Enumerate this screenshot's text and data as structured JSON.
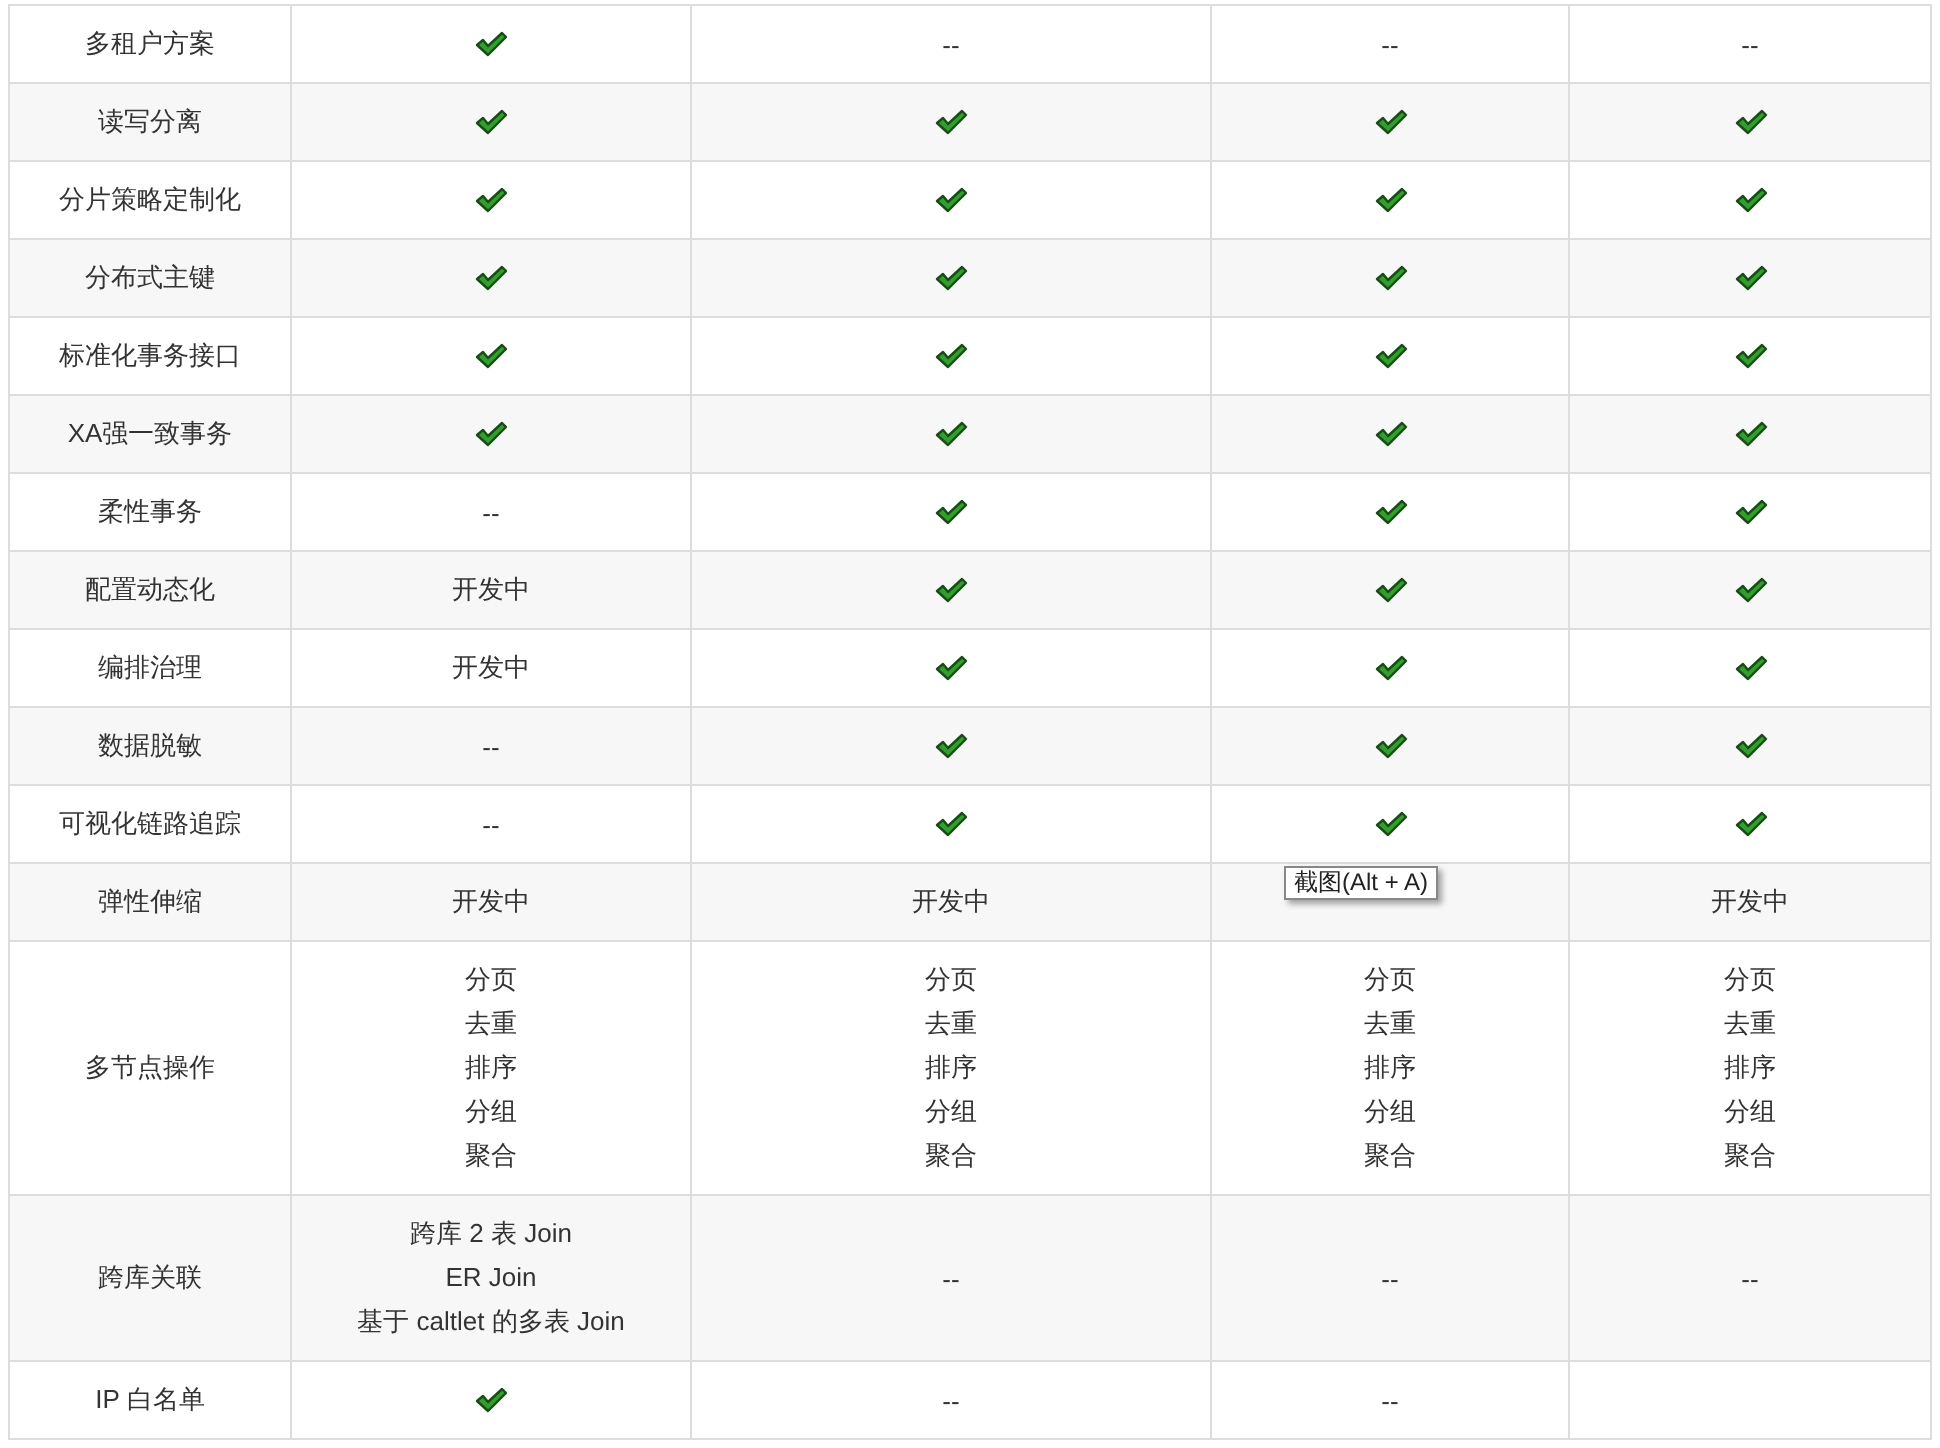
{
  "table": {
    "rows": [
      {
        "label": "多租户方案",
        "cells": [
          {
            "kind": "check"
          },
          {
            "kind": "text",
            "text": "--"
          },
          {
            "kind": "text",
            "text": "--"
          },
          {
            "kind": "text",
            "text": "--"
          }
        ]
      },
      {
        "label": "读写分离",
        "cells": [
          {
            "kind": "check"
          },
          {
            "kind": "check"
          },
          {
            "kind": "check"
          },
          {
            "kind": "check"
          }
        ]
      },
      {
        "label": "分片策略定制化",
        "cells": [
          {
            "kind": "check"
          },
          {
            "kind": "check"
          },
          {
            "kind": "check"
          },
          {
            "kind": "check"
          }
        ]
      },
      {
        "label": "分布式主键",
        "cells": [
          {
            "kind": "check"
          },
          {
            "kind": "check"
          },
          {
            "kind": "check"
          },
          {
            "kind": "check"
          }
        ]
      },
      {
        "label": "标准化事务接口",
        "cells": [
          {
            "kind": "check"
          },
          {
            "kind": "check"
          },
          {
            "kind": "check"
          },
          {
            "kind": "check"
          }
        ]
      },
      {
        "label": "XA强一致事务",
        "cells": [
          {
            "kind": "check"
          },
          {
            "kind": "check"
          },
          {
            "kind": "check"
          },
          {
            "kind": "check"
          }
        ]
      },
      {
        "label": "柔性事务",
        "cells": [
          {
            "kind": "text",
            "text": "--"
          },
          {
            "kind": "check"
          },
          {
            "kind": "check"
          },
          {
            "kind": "check"
          }
        ]
      },
      {
        "label": "配置动态化",
        "cells": [
          {
            "kind": "text",
            "text": "开发中"
          },
          {
            "kind": "check"
          },
          {
            "kind": "check"
          },
          {
            "kind": "check"
          }
        ]
      },
      {
        "label": "编排治理",
        "cells": [
          {
            "kind": "text",
            "text": "开发中"
          },
          {
            "kind": "check"
          },
          {
            "kind": "check"
          },
          {
            "kind": "check"
          }
        ]
      },
      {
        "label": "数据脱敏",
        "cells": [
          {
            "kind": "text",
            "text": "--"
          },
          {
            "kind": "check"
          },
          {
            "kind": "check"
          },
          {
            "kind": "check"
          }
        ]
      },
      {
        "label": "可视化链路追踪",
        "cells": [
          {
            "kind": "text",
            "text": "--"
          },
          {
            "kind": "check"
          },
          {
            "kind": "check"
          },
          {
            "kind": "check"
          }
        ]
      },
      {
        "label": "弹性伸缩",
        "cells": [
          {
            "kind": "text",
            "text": "开发中"
          },
          {
            "kind": "text",
            "text": "开发中"
          },
          {
            "kind": "empty",
            "tooltip": "截图(Alt + A)"
          },
          {
            "kind": "text",
            "text": "开发中"
          }
        ]
      },
      {
        "label": "多节点操作",
        "cells": [
          {
            "kind": "lines",
            "lines": [
              "分页",
              "去重",
              "排序",
              "分组",
              "聚合"
            ]
          },
          {
            "kind": "lines",
            "lines": [
              "分页",
              "去重",
              "排序",
              "分组",
              "聚合"
            ]
          },
          {
            "kind": "lines",
            "lines": [
              "分页",
              "去重",
              "排序",
              "分组",
              "聚合"
            ]
          },
          {
            "kind": "lines",
            "lines": [
              "分页",
              "去重",
              "排序",
              "分组",
              "聚合"
            ]
          }
        ]
      },
      {
        "label": "跨库关联",
        "cells": [
          {
            "kind": "lines",
            "lines": [
              "跨库 2 表 Join",
              "ER Join",
              "基于 caltlet 的多表 Join"
            ]
          },
          {
            "kind": "text",
            "text": "--"
          },
          {
            "kind": "text",
            "text": "--"
          },
          {
            "kind": "text",
            "text": "--"
          }
        ]
      },
      {
        "label": "IP 白名单",
        "cells": [
          {
            "kind": "check"
          },
          {
            "kind": "text",
            "text": "--"
          },
          {
            "kind": "text",
            "text": "--"
          },
          {
            "kind": "empty"
          }
        ]
      }
    ]
  }
}
